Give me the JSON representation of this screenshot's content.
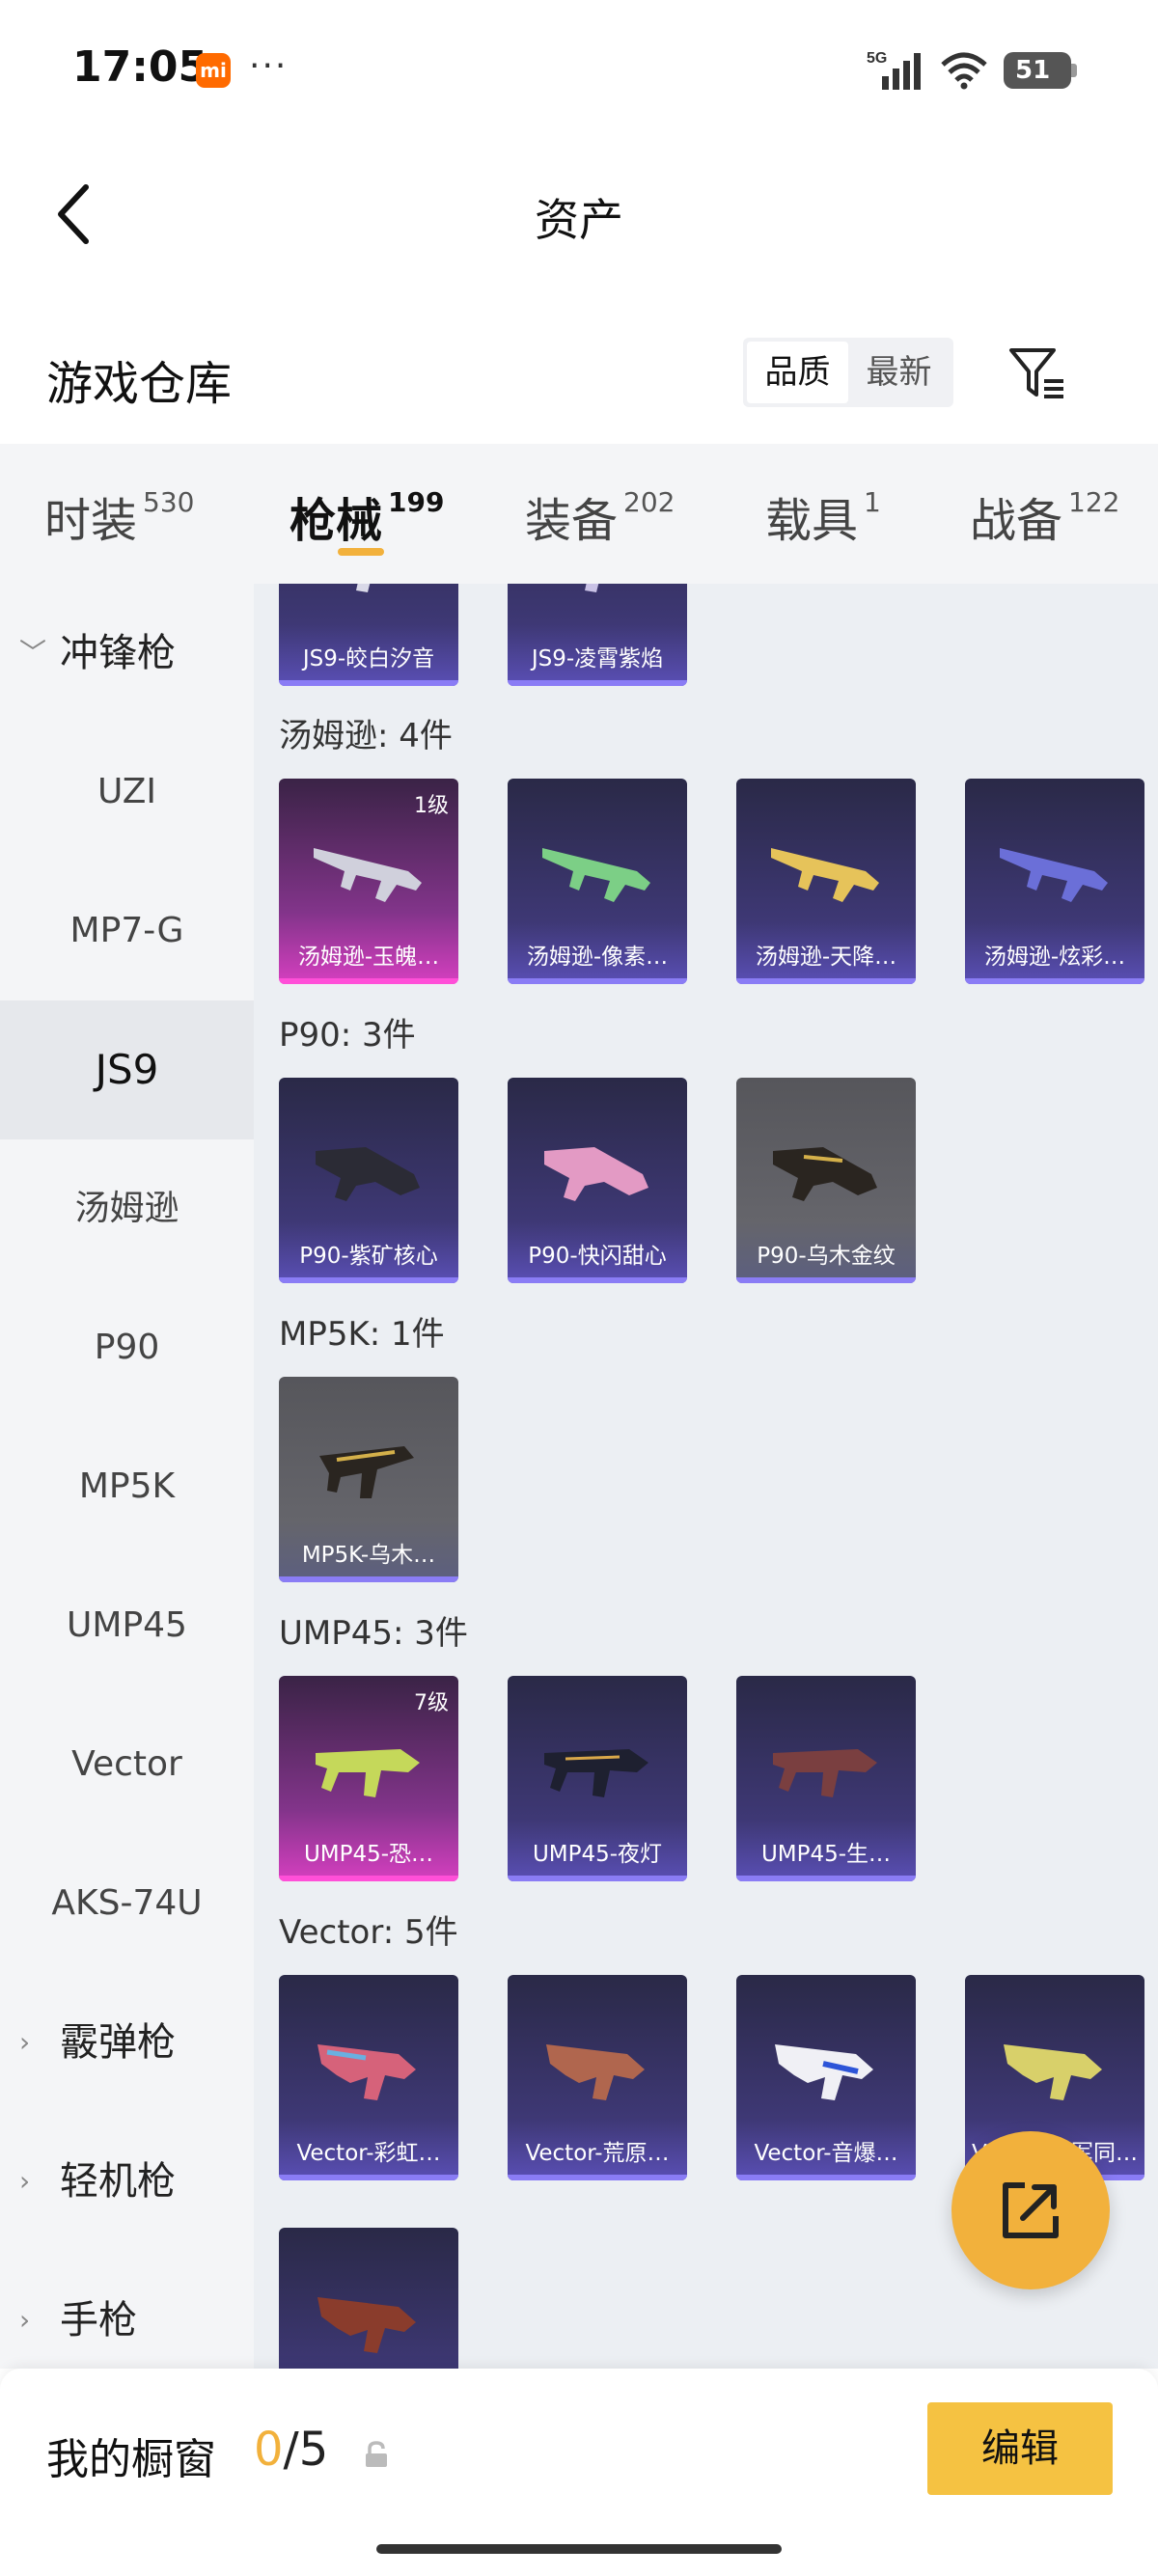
{
  "status_bar": {
    "time": "17:05",
    "mi_badge": "mi",
    "dots": "···",
    "network": "5G",
    "battery": "51"
  },
  "header": {
    "title": "资产"
  },
  "warehouse": {
    "title": "游戏仓库",
    "sort_options": [
      "品质",
      "最新"
    ],
    "sort_selected": "品质"
  },
  "category_tabs": [
    {
      "label": "时装",
      "count": "530",
      "active": false
    },
    {
      "label": "枪械",
      "count": "199",
      "active": true
    },
    {
      "label": "装备",
      "count": "202",
      "active": false
    },
    {
      "label": "载具",
      "count": "1",
      "active": false
    },
    {
      "label": "战备",
      "count": "122",
      "active": false
    }
  ],
  "sidebar": {
    "group_open": "冲锋枪",
    "items": [
      "UZI",
      "MP7-G",
      "JS9",
      "汤姆逊",
      "P90",
      "MP5K",
      "UMP45",
      "Vector",
      "AKS-74U"
    ],
    "active_item": "JS9",
    "groups_closed": [
      "霰弹枪",
      "轻机枪",
      "手枪"
    ]
  },
  "sections": [
    {
      "label": "",
      "items": [
        {
          "name": "JS9-皎白汐音",
          "level": ""
        },
        {
          "name": "JS9-凌霄紫焰",
          "level": ""
        }
      ]
    },
    {
      "label": "汤姆逊: 4件",
      "items": [
        {
          "name": "汤姆逊-玉魄…",
          "level": "1级"
        },
        {
          "name": "汤姆逊-像素…",
          "level": ""
        },
        {
          "name": "汤姆逊-天降…",
          "level": ""
        },
        {
          "name": "汤姆逊-炫彩…",
          "level": ""
        }
      ]
    },
    {
      "label": "P90: 3件",
      "items": [
        {
          "name": "P90-紫矿核心",
          "level": ""
        },
        {
          "name": "P90-快闪甜心",
          "level": ""
        },
        {
          "name": "P90-乌木金纹",
          "level": ""
        }
      ]
    },
    {
      "label": "MP5K: 1件",
      "items": [
        {
          "name": "MP5K-乌木…",
          "level": ""
        }
      ]
    },
    {
      "label": "UMP45: 3件",
      "items": [
        {
          "name": "UMP45-恐…",
          "level": "7级"
        },
        {
          "name": "UMP45-夜灯",
          "level": ""
        },
        {
          "name": "UMP45-生…",
          "level": ""
        }
      ]
    },
    {
      "label": "Vector: 5件",
      "items": [
        {
          "name": "Vector-彩虹…",
          "level": ""
        },
        {
          "name": "Vector-荒原…",
          "level": ""
        },
        {
          "name": "Vector-音爆…",
          "level": ""
        },
        {
          "name": "Vector-冠军同…",
          "level": ""
        },
        {
          "name": "",
          "level": ""
        }
      ]
    }
  ],
  "bottom": {
    "window_label": "我的橱窗",
    "window_current": "0",
    "window_max": "/5",
    "edit_label": "编辑"
  },
  "colors": {
    "accent": "#f2b13c",
    "edit_button": "#f5c242",
    "card_purple": "#3e3875",
    "card_pink": "#d63fc0",
    "card_gray": "#5c5f80"
  }
}
